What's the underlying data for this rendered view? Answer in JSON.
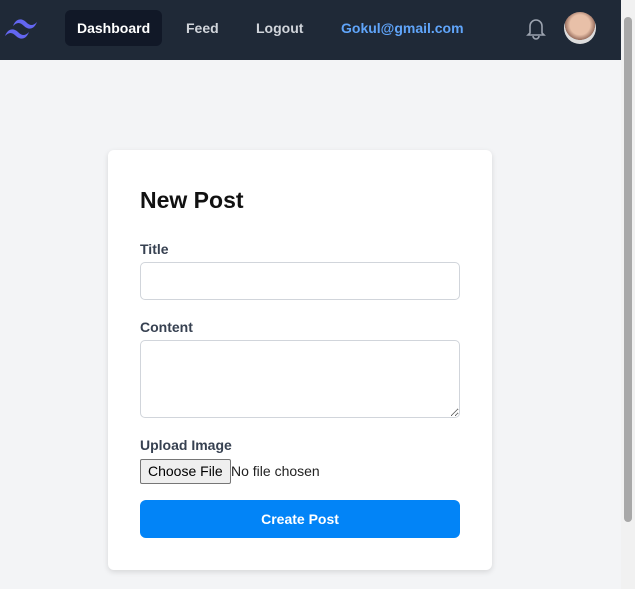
{
  "nav": {
    "links": [
      "Dashboard",
      "Feed",
      "Logout"
    ],
    "email": "Gokul@gmail.com"
  },
  "form": {
    "title": "New Post",
    "title_label": "Title",
    "content_label": "Content",
    "upload_label": "Upload Image",
    "choose_file": "Choose File",
    "no_file": "No file chosen",
    "submit": "Create Post"
  }
}
